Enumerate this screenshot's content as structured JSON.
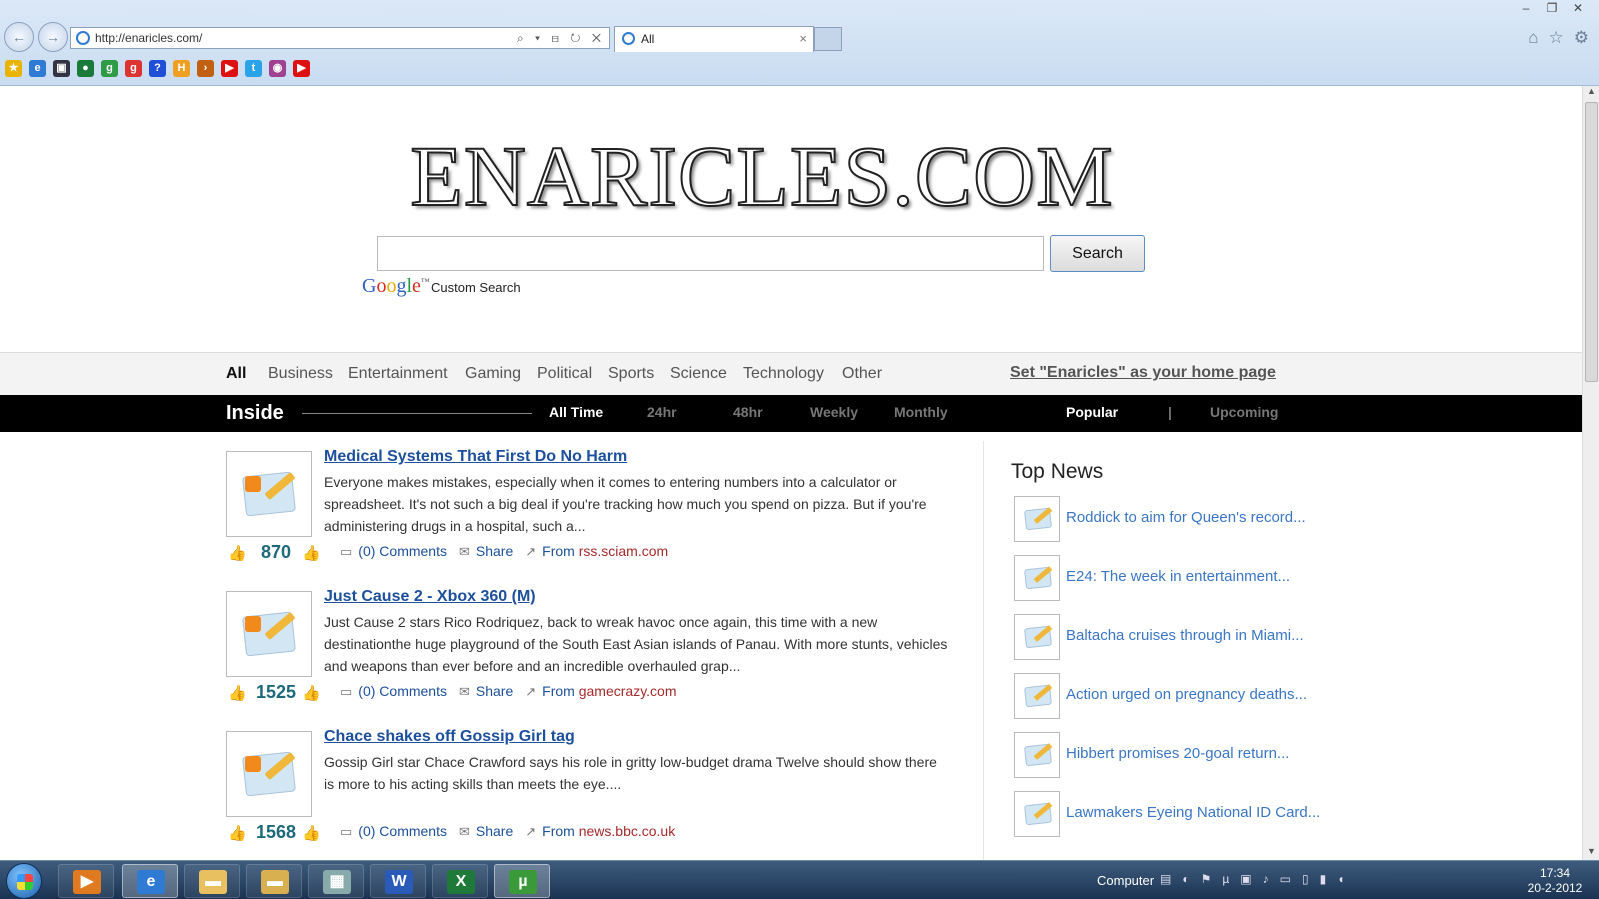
{
  "browser": {
    "url": "http://enaricles.com/",
    "tab_title": "All",
    "tab_close": "×",
    "window_controls": [
      "–",
      "❐",
      "✕"
    ],
    "nav_back": "←",
    "nav_forward": "→",
    "address_tools": "⌕ ▾ ⊟ ↻ ✕",
    "right_icons": [
      "home-icon",
      "favorites-star-icon",
      "tools-gear-icon"
    ],
    "favorites": [
      {
        "icon": "favorites-add-icon",
        "color": "#e8b400",
        "glyph": "★"
      },
      {
        "icon": "ie-page-icon",
        "color": "#2f7bd3",
        "glyph": "e"
      },
      {
        "icon": "clapper-icon",
        "color": "#334",
        "glyph": "▣"
      },
      {
        "icon": "globe-icon",
        "color": "#1a7a3a",
        "glyph": "●"
      },
      {
        "icon": "google-icon",
        "color": "#2f9b46",
        "glyph": "g"
      },
      {
        "icon": "google-apps-icon",
        "color": "#d33",
        "glyph": "g"
      },
      {
        "icon": "help-icon",
        "color": "#1f4fd6",
        "glyph": "?"
      },
      {
        "icon": "h-icon",
        "color": "#f0a020",
        "glyph": "H"
      },
      {
        "icon": "arrow-icon",
        "color": "#c06010",
        "glyph": "›"
      },
      {
        "icon": "youtube-icon",
        "color": "#d11",
        "glyph": "▶"
      },
      {
        "icon": "twitter-icon",
        "color": "#2aa3e8",
        "glyph": "t"
      },
      {
        "icon": "instagram-icon",
        "color": "#a04090",
        "glyph": "◉"
      },
      {
        "icon": "youtube-icon-2",
        "color": "#d11",
        "glyph": "▶"
      }
    ]
  },
  "site": {
    "logo": "ENARICLES.COM",
    "search_button": "Search",
    "google_letters": [
      "G",
      "o",
      "o",
      "g",
      "l",
      "e"
    ],
    "google_tm": "™",
    "custom_search": "Custom Search",
    "categories": [
      "All",
      "Business",
      "Entertainment",
      "Gaming",
      "Political",
      "Sports",
      "Science",
      "Technology",
      "Other"
    ],
    "active_category": "All",
    "homepage_link": "Set \"Enaricles\" as your home page",
    "inside_label": "Inside",
    "timeframes": [
      "All Time",
      "24hr",
      "48hr",
      "Weekly",
      "Monthly"
    ],
    "active_timeframe": "All Time",
    "sort_popular": "Popular",
    "sort_separator": "|",
    "sort_upcoming": "Upcoming"
  },
  "articles": [
    {
      "title": "Medical Systems That First Do No Harm",
      "text": "Everyone makes mistakes, especially when it comes to entering numbers into a calculator or spreadsheet. It's not such a big deal if you're tracking how much you spend on pizza. But if you're administering drugs in a hospital, such a...",
      "votes": "870",
      "comments": "(0) Comments",
      "share": "Share",
      "from_label": "From",
      "source": "rss.sciam.com"
    },
    {
      "title": "Just Cause 2 - Xbox 360 (M)",
      "text": "Just Cause 2 stars Rico Rodriquez, back to wreak havoc once again, this time with a new destinationthe huge playground of the South East Asian islands of Panau. With more stunts, vehicles and weapons than ever before and an incredible overhauled grap...",
      "votes": "1525",
      "comments": "(0) Comments",
      "share": "Share",
      "from_label": "From",
      "source": "gamecrazy.com"
    },
    {
      "title": "Chace shakes off Gossip Girl tag",
      "text": "Gossip Girl star Chace Crawford says his role in gritty low-budget drama Twelve should show there is more to his acting skills than meets the eye....",
      "votes": "1568",
      "comments": "(0) Comments",
      "share": "Share",
      "from_label": "From",
      "source": "news.bbc.co.uk"
    }
  ],
  "top_news": {
    "title": "Top News",
    "items": [
      "Roddick to aim for Queen's record...",
      "E24: The week in entertainment...",
      "Baltacha cruises through in Miami...",
      "Action urged on pregnancy deaths...",
      "Hibbert promises 20-goal return...",
      "Lawmakers Eyeing National ID Card..."
    ]
  },
  "taskbar": {
    "apps": [
      {
        "name": "media-player-icon",
        "glyph": "▶",
        "color": "#e07a20"
      },
      {
        "name": "internet-explorer-icon",
        "glyph": "e",
        "color": "#2f7bd3"
      },
      {
        "name": "folder-icon",
        "glyph": "▬",
        "color": "#e8c060"
      },
      {
        "name": "folder-2-icon",
        "glyph": "▬",
        "color": "#d8b050"
      },
      {
        "name": "calculator-icon",
        "glyph": "▦",
        "color": "#8aa"
      },
      {
        "name": "word-icon",
        "glyph": "W",
        "color": "#2b5bb8"
      },
      {
        "name": "excel-icon",
        "glyph": "X",
        "color": "#1f7a3a"
      },
      {
        "name": "utorrent-icon",
        "glyph": "µ",
        "color": "#3a9a3a"
      }
    ],
    "computer_label": "Computer",
    "tray": [
      "▤",
      "◐",
      "⚑",
      "µ",
      "▣",
      "♪",
      "▭",
      "▯",
      "▮",
      "◖"
    ],
    "time": "17:34",
    "date": "20-2-2012"
  }
}
